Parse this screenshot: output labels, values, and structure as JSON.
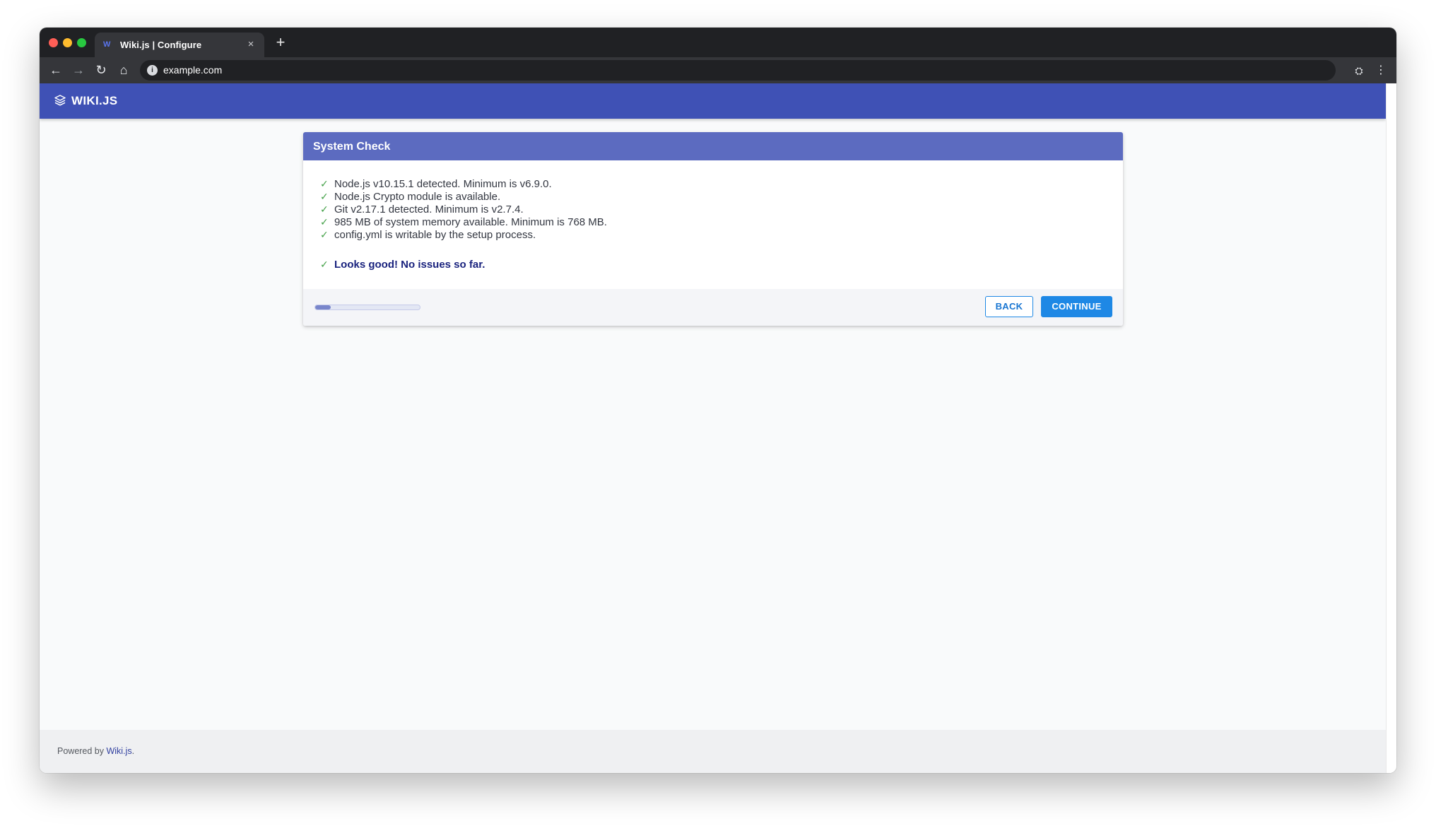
{
  "colors": {
    "traffic_red": "#ff5f57",
    "traffic_yellow": "#febc2e",
    "traffic_green": "#28c840",
    "app_bar": "#3f51b5",
    "card_header": "#5c6bc0",
    "check_green": "#43a047",
    "primary_button": "#1e88e5"
  },
  "browser": {
    "tab": {
      "favicon": "W",
      "title": "Wiki.js | Configure",
      "close_icon": "×"
    },
    "new_tab_icon": "+",
    "nav": {
      "back_icon": "←",
      "forward_icon": "→",
      "reload_icon": "↻",
      "home_icon": "⌂"
    },
    "url": "example.com",
    "site_info_icon": "i",
    "incognito_icon": "⛭",
    "menu_icon": "⋮"
  },
  "app": {
    "title": "WIKI.JS",
    "logo_icon": "layers-icon"
  },
  "card": {
    "title": "System Check",
    "checks": [
      "Node.js v10.15.1 detected. Minimum is v6.9.0.",
      "Node.js Crypto module is available.",
      "Git v2.17.1 detected. Minimum is v2.7.4.",
      "985 MB of system memory available. Minimum is 768 MB.",
      "config.yml is writable by the setup process."
    ],
    "check_icon": "✓",
    "summary": "Looks good! No issues so far.",
    "progress_percent": 15,
    "back_label": "BACK",
    "continue_label": "CONTINUE"
  },
  "footer": {
    "prefix": "Powered by ",
    "link": "Wiki.js",
    "suffix": "."
  }
}
